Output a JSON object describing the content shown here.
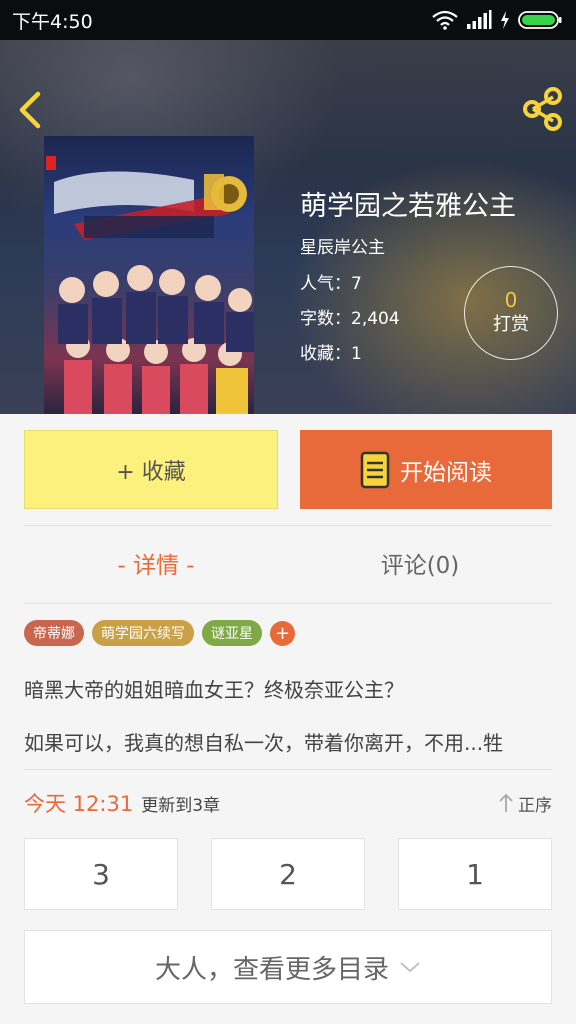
{
  "status_bar": {
    "time": "下午4:50"
  },
  "book": {
    "title": "萌学园之若雅公主",
    "author": "星辰岸公主",
    "popularity": "人气：7",
    "word_count": "字数：2,404",
    "favorites": "收藏：1"
  },
  "tip": {
    "count": "0",
    "label": "打赏"
  },
  "actions": {
    "collect_label": "+ 收藏",
    "read_label": "开始阅读"
  },
  "tabs": {
    "details": "- 详情 -",
    "comments": "评论(0)"
  },
  "tags": [
    {
      "label": "帝蒂娜",
      "color": "#c8664f"
    },
    {
      "label": "萌学园六续写",
      "color": "#c9a046"
    },
    {
      "label": "谜亚星",
      "color": "#7fa847"
    }
  ],
  "tag_add_label": "+",
  "description": {
    "line1": "暗黑大帝的姐姐暗血女王？终极奈亚公主？",
    "line2": "如果可以，我真的想自私一次，带着你离开，不用...牲"
  },
  "update": {
    "time": "今天 12:31",
    "text": "更新到3章",
    "sort_label": "正序"
  },
  "chapters": [
    "3",
    "2",
    "1"
  ],
  "more_label": "大人，查看更多目录",
  "colors": {
    "accent": "#e8693a",
    "collect_bg": "#fcf17c",
    "tip_count": "#f2c744"
  }
}
